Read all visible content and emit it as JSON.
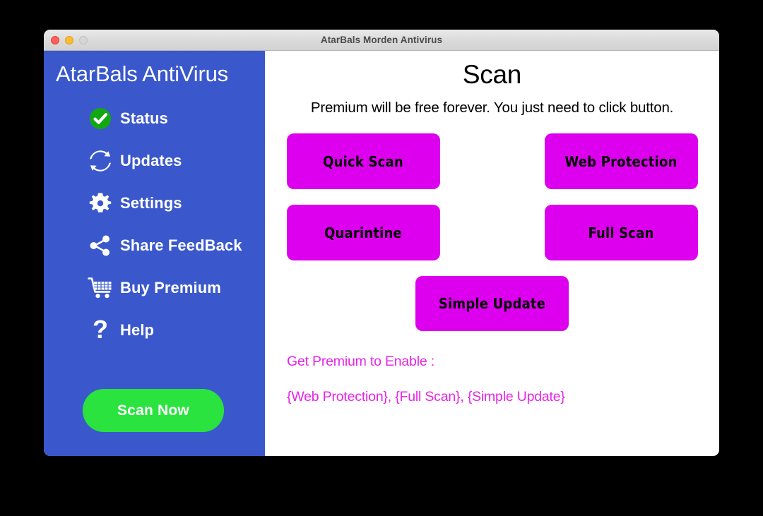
{
  "window": {
    "title": "AtarBals Morden Antivirus",
    "controls": [
      {
        "name": "close",
        "label": "Close",
        "color": "#ff5f57"
      },
      {
        "name": "minimize",
        "label": "Minimize",
        "color": "#febc2e"
      },
      {
        "name": "zoom",
        "label": "Zoom",
        "color": "#d6d6d6"
      }
    ]
  },
  "sidebar": {
    "brand": "AtarBals AntiVirus",
    "background_color": "#3a58cc",
    "items": [
      {
        "label": "Status",
        "icon": "check-circle-icon"
      },
      {
        "label": "Updates",
        "icon": "refresh-sync-icon"
      },
      {
        "label": "Settings",
        "icon": "gear-icon"
      },
      {
        "label": "Share FeedBack",
        "icon": "share-nodes-icon"
      },
      {
        "label": "Buy Premium",
        "icon": "shopping-cart-icon"
      },
      {
        "label": "Help",
        "icon": "question-mark-icon"
      }
    ],
    "scan_now_label": "Scan Now",
    "scan_now_color": "#2ae33f",
    "status_icon_color": "#13a813"
  },
  "main": {
    "title": "Scan",
    "subtitle": "Premium will be free forever. You just need to click button.",
    "button_color": "#dd00ee",
    "buttons": [
      {
        "label": "Quick Scan"
      },
      {
        "label": "Web Protection"
      },
      {
        "label": "Quarintine"
      },
      {
        "label": "Full Scan"
      },
      {
        "label": "Simple Update"
      }
    ],
    "premium_note_line1": "Get Premium to Enable :",
    "premium_note_line2": "{Web Protection}, {Full Scan}, {Simple Update}",
    "premium_note_color": "#e824e8"
  }
}
